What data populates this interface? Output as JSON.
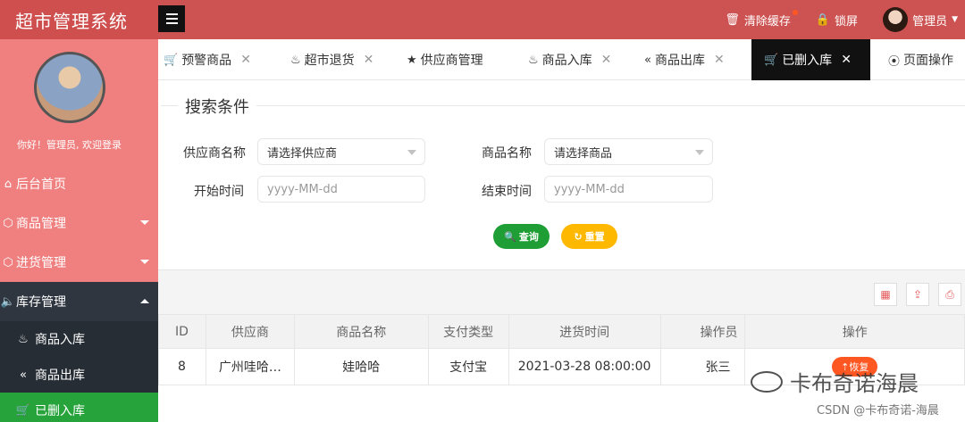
{
  "app": {
    "title": "超市管理系统"
  },
  "header": {
    "clear_cache": "清除缓存",
    "lock_screen": "锁屏",
    "user": "管理员"
  },
  "sidebar": {
    "welcome": "你好！管理员, 欢迎登录",
    "items": [
      {
        "label": "后台首页",
        "icon": "home-icon"
      },
      {
        "label": "商品管理",
        "icon": "cube-icon"
      },
      {
        "label": "进货管理",
        "icon": "cube-icon"
      },
      {
        "label": "库存管理",
        "icon": "speaker-icon"
      }
    ],
    "sub_items": [
      {
        "label": "商品入库",
        "icon": "fire-icon"
      },
      {
        "label": "商品出库",
        "icon": "double-chevron-left-icon"
      },
      {
        "label": "已删入库",
        "icon": "cart-icon"
      }
    ]
  },
  "tabs": [
    {
      "label": "预警商品",
      "icon": "cart-icon"
    },
    {
      "label": "超市退货",
      "icon": "fire-icon"
    },
    {
      "label": "供应商管理",
      "icon": "star-icon"
    },
    {
      "label": "商品入库",
      "icon": "fire-icon"
    },
    {
      "label": "商品出库",
      "icon": "double-chevron-left-icon"
    },
    {
      "label": "已删入库",
      "icon": "cart-icon"
    },
    {
      "label": "页面操作",
      "icon": "radio-icon"
    }
  ],
  "search": {
    "legend": "搜索条件",
    "supplier_label": "供应商名称",
    "supplier_value": "请选择供应商",
    "product_label": "商品名称",
    "product_value": "请选择商品",
    "start_label": "开始时间",
    "start_placeholder": "yyyy-MM-dd",
    "end_label": "结束时间",
    "end_placeholder": "yyyy-MM-dd",
    "query": "查询",
    "reset": "重置"
  },
  "table": {
    "columns": [
      "ID",
      "供应商",
      "商品名称",
      "支付类型",
      "进货时间",
      "操作员",
      "操作"
    ],
    "rows": [
      {
        "id": "8",
        "supplier": "广州哇哈…",
        "product": "娃哈哈",
        "pay": "支付宝",
        "time": "2021-03-28 08:00:00",
        "operator": "张三",
        "action": "恢复"
      }
    ]
  },
  "watermark": {
    "main": "卡布奇诺海晨",
    "csdn": "CSDN @卡布奇诺-海晨"
  },
  "colors": {
    "header": "#cd5352",
    "sidebar": "#f08080",
    "active_green": "#27a33c",
    "query_button": "#1e9e34",
    "reset_button": "#ffb800",
    "restore_button": "#ff5722"
  }
}
